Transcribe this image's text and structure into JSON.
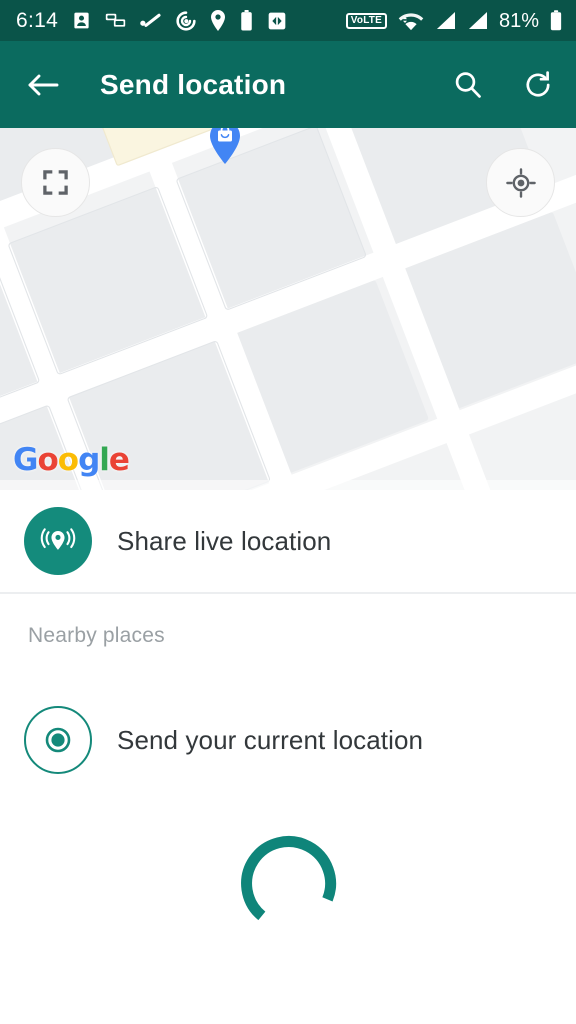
{
  "status_bar": {
    "time": "6:14",
    "battery_percent": "81%",
    "volte_label": "VoLTE",
    "background_color": "#0a5449",
    "icons": [
      "contact-icon",
      "screen-cast-icon",
      "check-mark-icon",
      "alarm-record-icon",
      "location-pin-icon",
      "battery-saver-icon",
      "data-transfer-icon",
      "volte-badge-icon",
      "wifi-icon",
      "signal-bars-sim1-icon",
      "signal-bars-sim2-icon",
      "battery-icon"
    ]
  },
  "app_bar": {
    "title": "Send location",
    "back_label": "Back",
    "search_label": "Search",
    "refresh_label": "Refresh",
    "background_color": "#0b6b5f",
    "text_color": "#ffffff"
  },
  "map": {
    "provider_logo": "Google",
    "logo_letters": [
      {
        "char": "G",
        "color": "#4285f4"
      },
      {
        "char": "o",
        "color": "#ea4335"
      },
      {
        "char": "o",
        "color": "#fbbc05"
      },
      {
        "char": "g",
        "color": "#4285f4"
      },
      {
        "char": "l",
        "color": "#34a853"
      },
      {
        "char": "e",
        "color": "#ea4335"
      }
    ],
    "expand_button_label": "Expand map",
    "locate_button_label": "My location",
    "poi_marker_label": "shop-marker",
    "poi_marker_color": "#4285f4",
    "background_color": "#f2f3f4",
    "road_color": "#ffffff",
    "building_color": "#eaecee",
    "landmark_color": "#faf5e0"
  },
  "list": {
    "share_live_location": {
      "label": "Share live location",
      "icon": "live-location-broadcast-icon",
      "icon_color": "#148b7c"
    },
    "section_title": "Nearby places",
    "send_current_location": {
      "label": "Send your current location",
      "icon": "current-location-target-icon",
      "icon_color": "#14897a"
    },
    "loading": {
      "label": "Loading nearby places",
      "spinner_color": "#0f857a"
    }
  }
}
